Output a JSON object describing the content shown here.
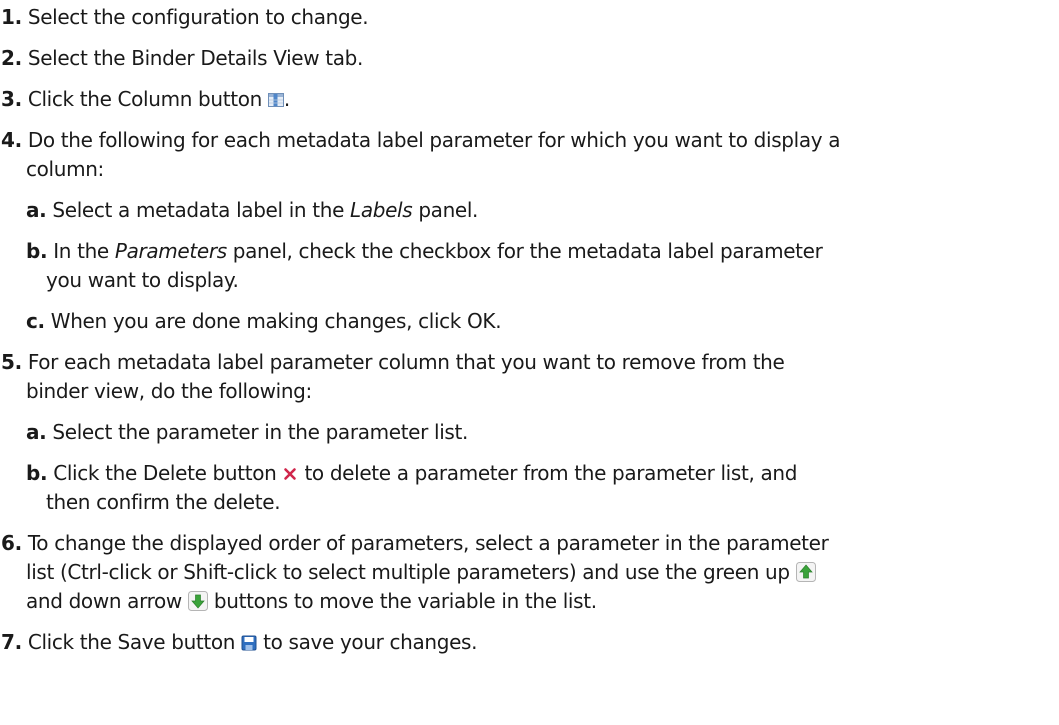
{
  "steps": [
    {
      "num": "1.",
      "text": "Select the configuration to change."
    },
    {
      "num": "2.",
      "text": "Select the Binder Details View tab."
    },
    {
      "num": "3.",
      "text_before": "Click the Column button ",
      "text_after": ".",
      "icon": "column-icon"
    },
    {
      "num": "4.",
      "line1": "Do the following for each metadata label parameter for which you want to display a",
      "line2": "column:",
      "substeps": [
        {
          "num": "a.",
          "before": "Select a metadata label in the ",
          "em": "Labels",
          "after": " panel."
        },
        {
          "num": "b.",
          "before": "In the ",
          "em": "Parameters",
          "after": " panel, check the checkbox for the metadata label parameter",
          "line2": "you want to display."
        },
        {
          "num": "c.",
          "text": "When you are done making changes, click OK."
        }
      ]
    },
    {
      "num": "5.",
      "line1": "For each metadata label parameter column that you want to remove from the",
      "line2": "binder view, do the following:",
      "substeps": [
        {
          "num": "a.",
          "text": "Select the parameter in the parameter list."
        },
        {
          "num": "b.",
          "before": "Click the Delete button ",
          "after": " to delete a parameter from the parameter list, and",
          "line2": "then confirm the delete.",
          "icon": "delete-icon"
        }
      ]
    },
    {
      "num": "6.",
      "line1": "To change the displayed order of parameters, select a parameter in the parameter",
      "line2": "list (Ctrl-click or Shift-click to select multiple parameters) and use the green up ",
      "line3_before": "and down arrow ",
      "line3_after": " buttons to move the variable in the list.",
      "icons": [
        "up-arrow-icon",
        "down-arrow-icon"
      ]
    },
    {
      "num": "7.",
      "text_before": "Click the Save button ",
      "text_after": " to save your changes.",
      "icon": "save-icon"
    }
  ],
  "colors": {
    "text": "#1a1a1a",
    "delete_icon": "#d0264b",
    "arrow_green": "#3aa33a",
    "save_blue": "#2f6fc0"
  }
}
